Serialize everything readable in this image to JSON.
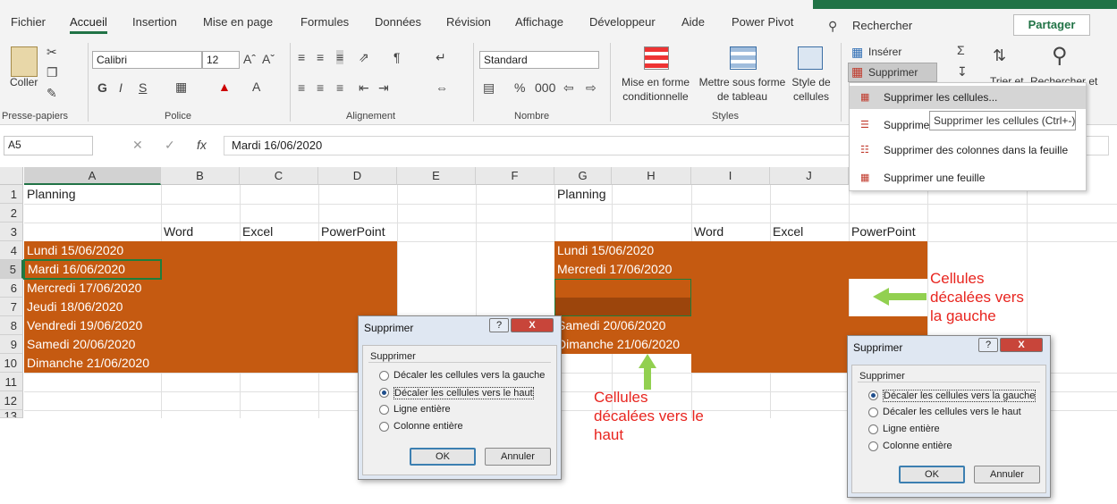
{
  "ribbon": {
    "tabs": [
      "Fichier",
      "Accueil",
      "Insertion",
      "Mise en page",
      "Formules",
      "Données",
      "Révision",
      "Affichage",
      "Développeur",
      "Aide",
      "Power Pivot"
    ],
    "search": "Rechercher",
    "share": "Partager",
    "paste": "Coller",
    "font_name": "Calibri",
    "font_size": "12",
    "bold": "G",
    "italic": "I",
    "underline": "S",
    "number_format": "Standard",
    "percent": "%",
    "thousands": "000",
    "cond_format": "Mise en forme conditionnelle",
    "table_format": "Mettre sous forme de tableau",
    "cell_styles": "Style de cellules",
    "insert": "Insérer",
    "delete": "Supprimer",
    "sort": "Trier et",
    "find": "Rechercher et",
    "groups": {
      "clipboard": "Presse-papiers",
      "font": "Police",
      "align": "Alignement",
      "number": "Nombre",
      "styles": "Styles"
    }
  },
  "menu": {
    "items": [
      "Supprimer les cellules...",
      "Supprimer des lignes dans la feuille",
      "Supprimer des colonnes dans la feuille",
      "Supprimer une feuille"
    ],
    "item2_visible": "Supprime",
    "tooltip": "Supprimer les cellules (Ctrl+-)"
  },
  "formula": {
    "namebox": "A5",
    "fx": "fx",
    "value": "Mardi 16/06/2020"
  },
  "columns": [
    "A",
    "B",
    "C",
    "D",
    "E",
    "F",
    "G",
    "H",
    "I",
    "J"
  ],
  "rows": [
    "1",
    "2",
    "3",
    "4",
    "5",
    "6",
    "7",
    "8",
    "9",
    "10",
    "11",
    "12",
    "13"
  ],
  "left_sheet": {
    "a1": "Planning",
    "headers": [
      "Word",
      "Excel",
      "PowerPoint"
    ],
    "days": [
      "Lundi 15/06/2020",
      "Mardi 16/06/2020",
      "Mercredi 17/06/2020",
      "Jeudi 18/06/2020",
      "Vendredi 19/06/2020",
      "Samedi 20/06/2020",
      "Dimanche 21/06/2020"
    ]
  },
  "right_sheet": {
    "g1": "Planning",
    "headers": [
      "Word",
      "Excel",
      "PowerPoint"
    ],
    "days": [
      "Lundi 15/06/2020",
      "Mercredi 17/06/2020",
      "Samedi 20/06/2020",
      "Dimanche 21/06/2020"
    ]
  },
  "dialog": {
    "title": "Supprimer",
    "group": "Supprimer",
    "options": [
      "Décaler les cellules vers la gauche",
      "Décaler les cellules vers le haut",
      "Ligne entière",
      "Colonne entière"
    ],
    "ok": "OK",
    "cancel": "Annuler",
    "help": "?",
    "close": "X"
  },
  "annotations": {
    "left": [
      "Cellules",
      "décalées vers",
      "la gauche"
    ],
    "up": [
      "Cellules",
      "décalées vers le",
      "haut"
    ]
  },
  "colors": {
    "excel_green": "#217346",
    "cell_orange": "#c55a11",
    "annotation_red": "#e8251f",
    "arrow_green": "#92d050"
  }
}
